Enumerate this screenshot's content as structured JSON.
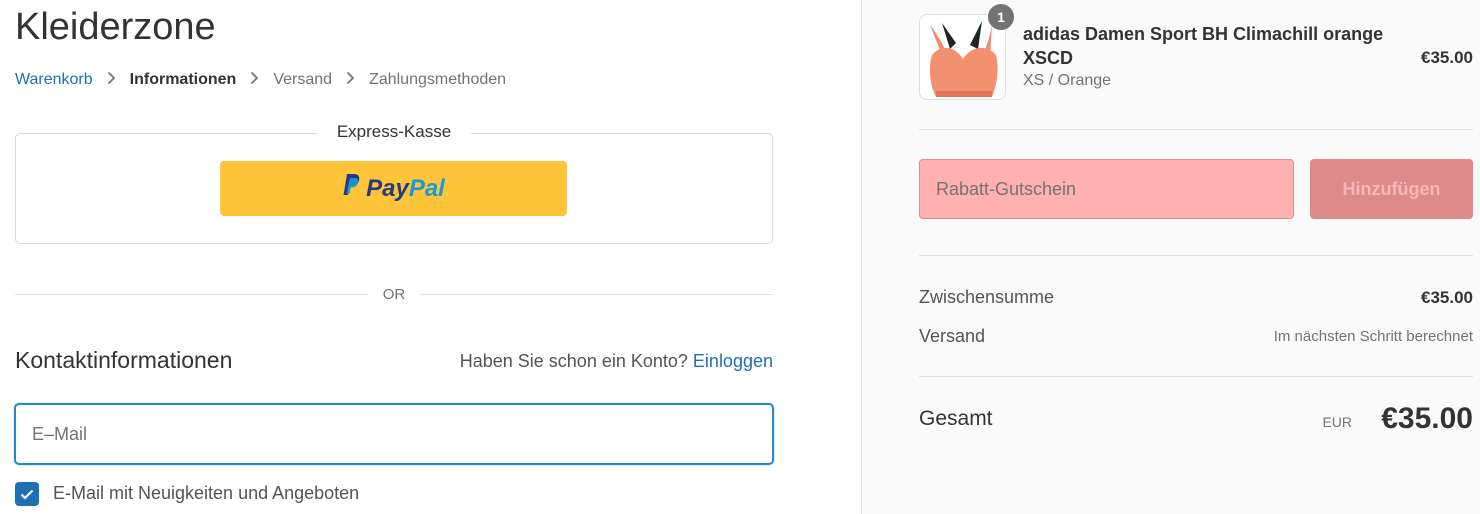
{
  "store": {
    "title": "Kleiderzone"
  },
  "breadcrumb": {
    "items": [
      {
        "label": "Warenkorb"
      },
      {
        "label": "Informationen"
      },
      {
        "label": "Versand"
      },
      {
        "label": "Zahlungsmethoden"
      }
    ]
  },
  "express": {
    "title": "Express-Kasse",
    "paypal_pay": "Pay",
    "paypal_pal": "Pal"
  },
  "divider_text": "OR",
  "contact": {
    "title": "Kontaktinformationen",
    "account_prompt": "Haben Sie schon ein Konto?",
    "login_label": "Einloggen",
    "email_placeholder": "E–Mail",
    "newsletter_label": "E-Mail mit Neuigkeiten und Angeboten",
    "newsletter_checked": true
  },
  "cart": {
    "quantity": "1",
    "product_name": "adidas Damen Sport BH Climachill orange XSCD",
    "variant": "XS / Orange",
    "price": "€35.00",
    "coupon_placeholder": "Rabatt-Gutschein",
    "coupon_button": "Hinzufügen",
    "subtotal_label": "Zwischensumme",
    "subtotal_value": "€35.00",
    "shipping_label": "Versand",
    "shipping_value": "Im nächsten Schritt berechnet",
    "total_label": "Gesamt",
    "total_currency": "EUR",
    "total_value": "€35.00"
  },
  "colors": {
    "accent": "#1f6fb5",
    "paypal_yellow": "#ffc439",
    "coupon_error_bg": "#ffb0b0",
    "coupon_button_bg": "#de8a8a"
  }
}
